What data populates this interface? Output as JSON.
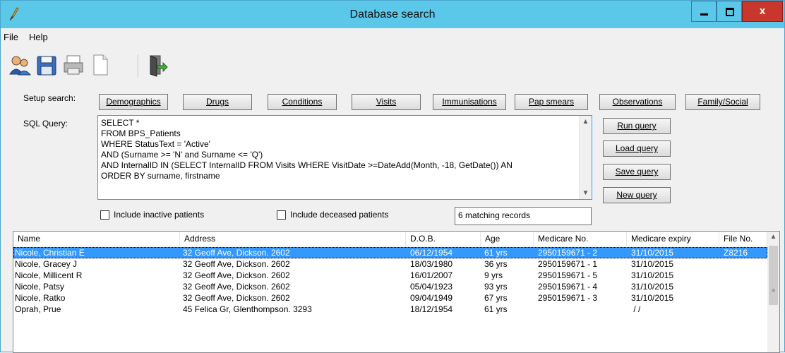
{
  "window": {
    "title": "Database search",
    "close_glyph": "x"
  },
  "menu": [
    "File",
    "Help"
  ],
  "toolbar": [
    {
      "icon": "users-icon"
    },
    {
      "icon": "save-icon"
    },
    {
      "icon": "printer-icon"
    },
    {
      "icon": "new-document-icon"
    },
    {
      "icon": "exit-door-icon"
    }
  ],
  "setup": {
    "label": "Setup search:",
    "buttons": [
      "Demographics",
      "Drugs",
      "Conditions",
      "Visits",
      "Immunisations",
      "Pap smears",
      "Observations",
      "Family/Social"
    ]
  },
  "sql": {
    "label": "SQL Query:",
    "lines": [
      "SELECT *",
      "FROM BPS_Patients",
      "WHERE StatusText = 'Active'",
      "AND (Surname >= 'N' and Surname <= 'Q')",
      "AND InternalID IN (SELECT InternalID FROM Visits WHERE VisitDate >=DateAdd(Month, -18, GetDate()) AN",
      "ORDER BY surname, firstname"
    ]
  },
  "query_buttons": [
    "Run query",
    "Load query",
    "Save query",
    "New query"
  ],
  "options": {
    "include_inactive": {
      "label": "Include inactive patients",
      "checked": false
    },
    "include_deceased": {
      "label": "Include deceased patients",
      "checked": false
    }
  },
  "match_count": "6 matching records",
  "results": {
    "columns": [
      "Name",
      "Address",
      "D.O.B.",
      "Age",
      "Medicare No.",
      "Medicare expiry",
      "File No."
    ],
    "rows": [
      [
        "Nicole, Christian E",
        "32 Geoff Ave, Dickson. 2602",
        "06/12/1954",
        "61 yrs",
        "2950159671 - 2",
        "31/10/2015",
        "Z8216"
      ],
      [
        "Nicole, Gracey J",
        "32 Geoff Ave, Dickson. 2602",
        "18/03/1980",
        "36 yrs",
        "2950159671 - 1",
        "31/10/2015",
        ""
      ],
      [
        "Nicole, Millicent R",
        "32 Geoff Ave, Dickson. 2602",
        "16/01/2007",
        "9 yrs",
        "2950159671 - 5",
        "31/10/2015",
        ""
      ],
      [
        "Nicole, Patsy",
        "32 Geoff Ave, Dickson. 2602",
        "05/04/1923",
        "93 yrs",
        "2950159671 - 4",
        "31/10/2015",
        ""
      ],
      [
        "Nicole, Ratko",
        "32 Geoff Ave, Dickson. 2602",
        "09/04/1949",
        "67 yrs",
        "2950159671 - 3",
        "31/10/2015",
        ""
      ],
      [
        "Oprah, Prue",
        "45 Felica Gr, Glenthompson. 3293",
        "18/12/1954",
        "61 yrs",
        "",
        " / /",
        ""
      ]
    ],
    "selected_row": 0
  },
  "colors": {
    "titlebar": "#5bc8ea",
    "selection": "#3399ff",
    "close": "#c7372b"
  }
}
